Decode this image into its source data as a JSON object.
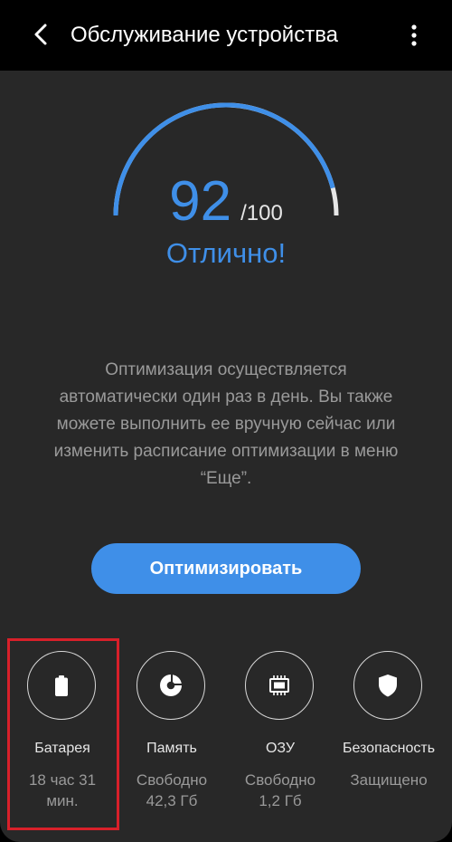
{
  "header": {
    "title": "Обслуживание устройства",
    "back_icon": "chevron-left-icon",
    "more_icon": "more-vertical-icon"
  },
  "score": {
    "value": "92",
    "max": "/100",
    "status": "Отлично!",
    "gauge_fraction": 0.92,
    "accent_color": "#3f8fe8"
  },
  "description": {
    "lines": [
      "Оптимизация осуществляется",
      "автоматически один раз в день. Вы также",
      "можете выполнить ее вручную сейчас или",
      "изменить расписание оптимизации в меню",
      "“Еще”."
    ]
  },
  "optimize_button": {
    "label": "Оптимизировать"
  },
  "tiles": [
    {
      "icon": "battery-icon",
      "label": "Батарея",
      "value_lines": [
        "18 час 31",
        "мин."
      ]
    },
    {
      "icon": "storage-pie-icon",
      "label": "Память",
      "value_lines": [
        "Свободно",
        "42,3 Гб"
      ]
    },
    {
      "icon": "memory-chip-icon",
      "label": "ОЗУ",
      "value_lines": [
        "Свободно",
        "1,2 Гб"
      ]
    },
    {
      "icon": "shield-icon",
      "label": "Безопасность",
      "value_lines": [
        "Защищено"
      ]
    }
  ]
}
